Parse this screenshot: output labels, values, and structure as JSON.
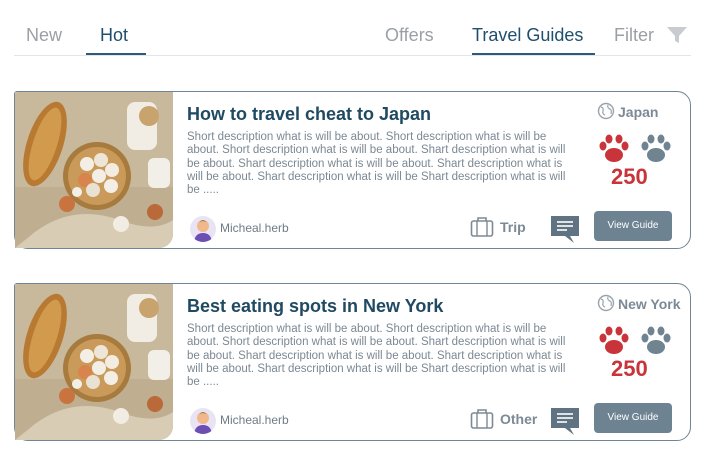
{
  "tabs": {
    "new": "New",
    "hot": "Hot",
    "offers": "Offers",
    "travel_guides": "Travel Guides",
    "filter": "Filter"
  },
  "colors": {
    "accent": "#1f4f6e",
    "vote": "#c9343a",
    "button": "#6e8392"
  },
  "icons": [
    "filter-funnel-icon",
    "globe-icon",
    "paw-red-icon",
    "paw-grey-icon",
    "suitcase-icon",
    "comment-icon"
  ],
  "cards": [
    {
      "title": "How to travel cheat to Japan",
      "description": "Short description what is will be about. Short description what is will be about. Short description what is will be about. Shart description what is will be about. Shart description what is will be about. Shart description what is will be about. Shart description what is will be Shart description what is will be .....",
      "author": "Micheal.herb",
      "category": "Trip",
      "location": "Japan",
      "votes": "250",
      "button": "View Guide"
    },
    {
      "title": "Best eating spots in New York",
      "description": "Short description what is will be about. Short description what is will be about. Short description what is will be about. Shart description what is will be about. Shart description what is will be about. Shart description what is will be about. Shart description what is will be Shart description what is will be .....",
      "author": "Micheal.herb",
      "category": "Other",
      "location": "New York",
      "votes": "250",
      "button": "View Guide"
    }
  ]
}
